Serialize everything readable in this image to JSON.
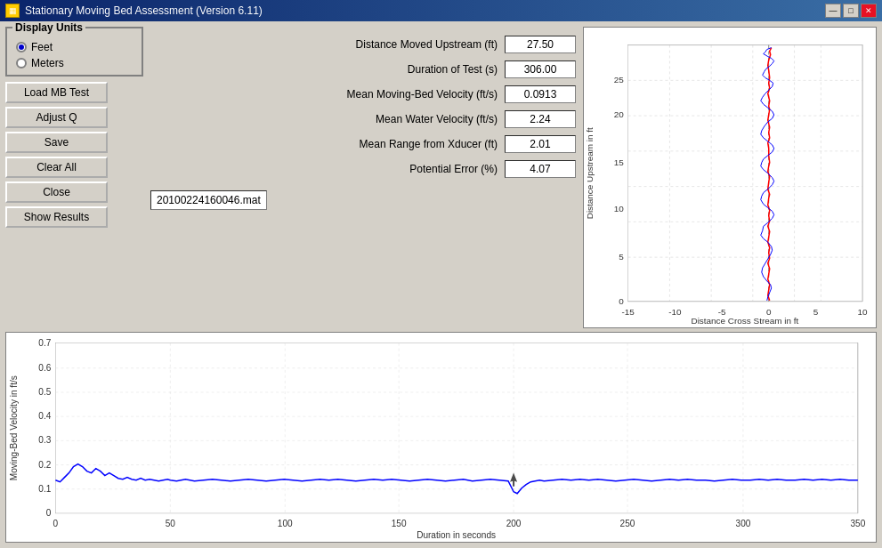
{
  "titleBar": {
    "title": "Stationary Moving Bed Assessment  (Version 6.11)",
    "minimize": "—",
    "maximize": "□",
    "close": "✕"
  },
  "displayUnits": {
    "label": "Display Units",
    "options": [
      "Feet",
      "Meters"
    ],
    "selected": "Feet"
  },
  "buttons": {
    "loadMBTest": "Load MB Test",
    "adjustQ": "Adjust Q",
    "save": "Save",
    "clearAll": "Clear All",
    "close": "Close",
    "showResults": "Show Results"
  },
  "fields": {
    "distanceMoved": {
      "label": "Distance Moved Upstream (ft)",
      "value": "27.50"
    },
    "durationOfTest": {
      "label": "Duration of Test (s)",
      "value": "306.00"
    },
    "meanMovingBed": {
      "label": "Mean Moving-Bed Velocity (ft/s)",
      "value": "0.0913"
    },
    "meanWater": {
      "label": "Mean Water Velocity (ft/s)",
      "value": "2.24"
    },
    "meanRange": {
      "label": "Mean Range from Xducer (ft)",
      "value": "2.01"
    },
    "potentialError": {
      "label": "Potential Error (%)",
      "value": "4.07"
    }
  },
  "filename": "20100224160046.mat",
  "scatterChart": {
    "xAxisLabel": "Distance Cross Stream in ft",
    "yAxisLabel": "Distance Upstream in ft",
    "xMin": -15,
    "xMax": 10,
    "yMin": 0,
    "yMax": 27
  },
  "lineChart": {
    "xAxisLabel": "Duration in seconds",
    "yAxisLabel": "Moving-Bed Velocity in ft/s",
    "xMin": 0,
    "xMax": 350,
    "yMin": 0,
    "yMax": 0.7
  }
}
